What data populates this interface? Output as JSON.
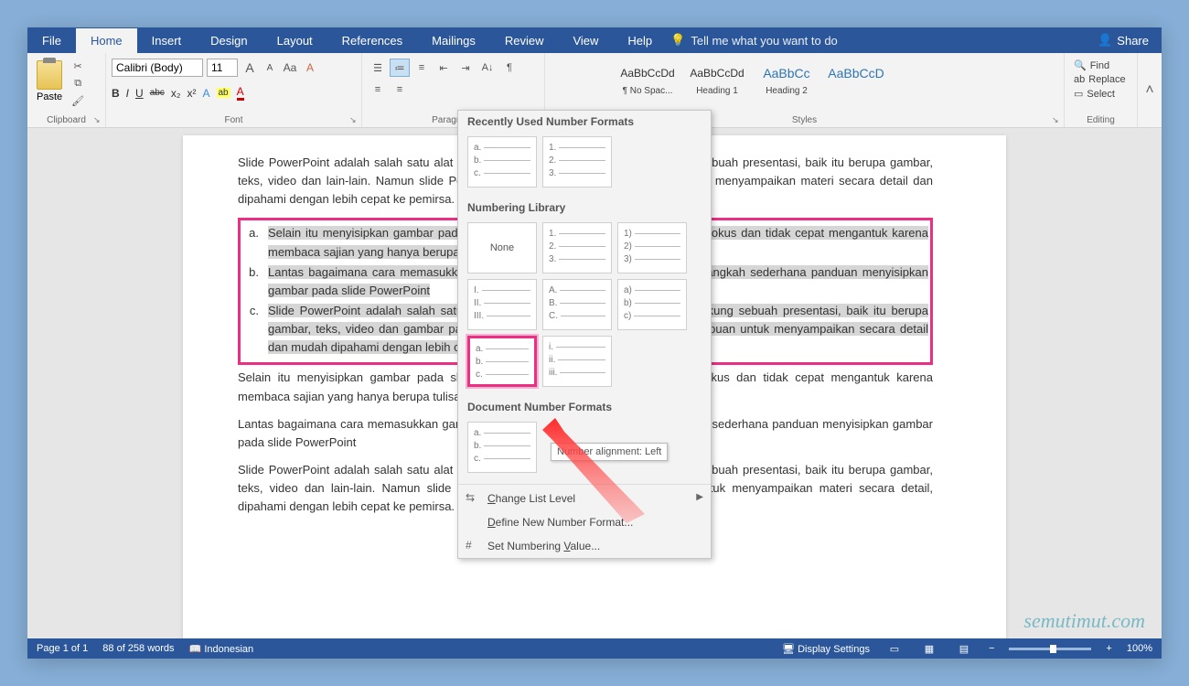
{
  "menubar": {
    "tabs": [
      "File",
      "Home",
      "Insert",
      "Design",
      "Layout",
      "References",
      "Mailings",
      "Review",
      "View",
      "Help"
    ],
    "active_index": 1,
    "tell_me": "Tell me what you want to do",
    "share": "Share"
  },
  "ribbon": {
    "clipboard": {
      "label": "Clipboard",
      "paste": "Paste"
    },
    "font": {
      "label": "Font",
      "name": "Calibri (Body)",
      "size": "11",
      "grow": "A",
      "shrink": "A",
      "case": "Aa",
      "clear": "A",
      "b": "B",
      "i": "I",
      "u": "U",
      "strike": "abc",
      "sub": "x₂",
      "sup": "x²",
      "text_effect": "A",
      "highlight": "ab",
      "font_color": "A"
    },
    "paragraph": {
      "label": "Paragraph"
    },
    "styles": {
      "label": "Styles",
      "items": [
        {
          "preview": "AaBbCcDd",
          "name": "¶ No Spac..."
        },
        {
          "preview": "AaBbCcDd",
          "name": "Heading 1"
        },
        {
          "preview": "AaBbCc",
          "name": "Heading 2",
          "heading": true
        },
        {
          "preview": "AaBbCcD",
          "name": "",
          "heading": true
        }
      ]
    },
    "editing": {
      "label": "Editing",
      "find": "Find",
      "replace": "Replace",
      "select": "Select"
    }
  },
  "document": {
    "p1": "Slide PowerPoint adalah salah satu alat yang banyak digunakan sebagai pendukung sebuah presentasi, baik itu berupa gambar, teks, video dan lain-lain. Namun slide PowerPoint ternyata memiliki kemampuan untuk menyampaikan materi secara detail dan dipahami dengan lebih cepat ke pemirsa.",
    "list": [
      {
        "marker": "a.",
        "text": "Selain itu menyisipkan gambar pada slide PowerPoint membuat pendengar lebih fokus dan tidak cepat mengantuk karena membaca sajian yang hanya berupa tulisan atau teks semata."
      },
      {
        "marker": "b.",
        "text": "Lantas bagaimana cara memasukkan gambar di PowerPoint? Berikut beberapa langkah sederhana panduan menyisipkan gambar pada slide PowerPoint"
      },
      {
        "marker": "c.",
        "text": "Slide PowerPoint adalah salah satu alat yang banyak digunakan sebagai pendukung sebuah presentasi, baik itu berupa gambar, teks, video dan gambar pada slide PowerPoint ternyata memiliki kemampuan untuk menyampaikan secara detail dan mudah dipahami dengan lebih cepat ke pemirsa."
      }
    ],
    "p2": "Selain itu menyisipkan gambar pada slide PowerPoint membuat pendengar lebih fokus dan tidak cepat mengantuk karena membaca sajian yang hanya berupa tulisan atau teks semata.",
    "p3": "Lantas bagaimana cara memasukkan gambar di PowerPoint? Berikut beberapa langkah sederhana panduan menyisipkan gambar pada slide PowerPoint",
    "p4": "Slide PowerPoint adalah salah satu alat yang banyak digunakan sebagai pendukung sebuah presentasi, baik itu berupa gambar, teks, video dan lain-lain. Namun slide PowerPoint ternyata memiliki kemampuan untuk menyampaikan materi secara detail, dipahami dengan lebih cepat ke pemirsa."
  },
  "dropdown": {
    "section_recent": "Recently Used Number Formats",
    "section_library": "Numbering Library",
    "section_doc": "Document Number Formats",
    "none": "None",
    "change_level": "Change List Level",
    "define_new": "Define New Number Format...",
    "set_value": "Set Numbering Value...",
    "formats": {
      "abc_dot": [
        "a.",
        "b.",
        "c."
      ],
      "num_dot": [
        "1.",
        "2.",
        "3."
      ],
      "num_paren": [
        "1)",
        "2)",
        "3)"
      ],
      "roman_upper": [
        "I.",
        "II.",
        "III."
      ],
      "ABC_dot": [
        "A.",
        "B.",
        "C."
      ],
      "abc_paren": [
        "a)",
        "b)",
        "c)"
      ],
      "roman_lower": [
        "i.",
        "ii.",
        "iii."
      ]
    }
  },
  "tooltip": "Number alignment: Left",
  "statusbar": {
    "page": "Page 1 of 1",
    "words": "88 of 258 words",
    "lang": "Indonesian",
    "display_settings": "Display Settings",
    "zoom": "100%"
  },
  "watermark": "semutimut.com"
}
